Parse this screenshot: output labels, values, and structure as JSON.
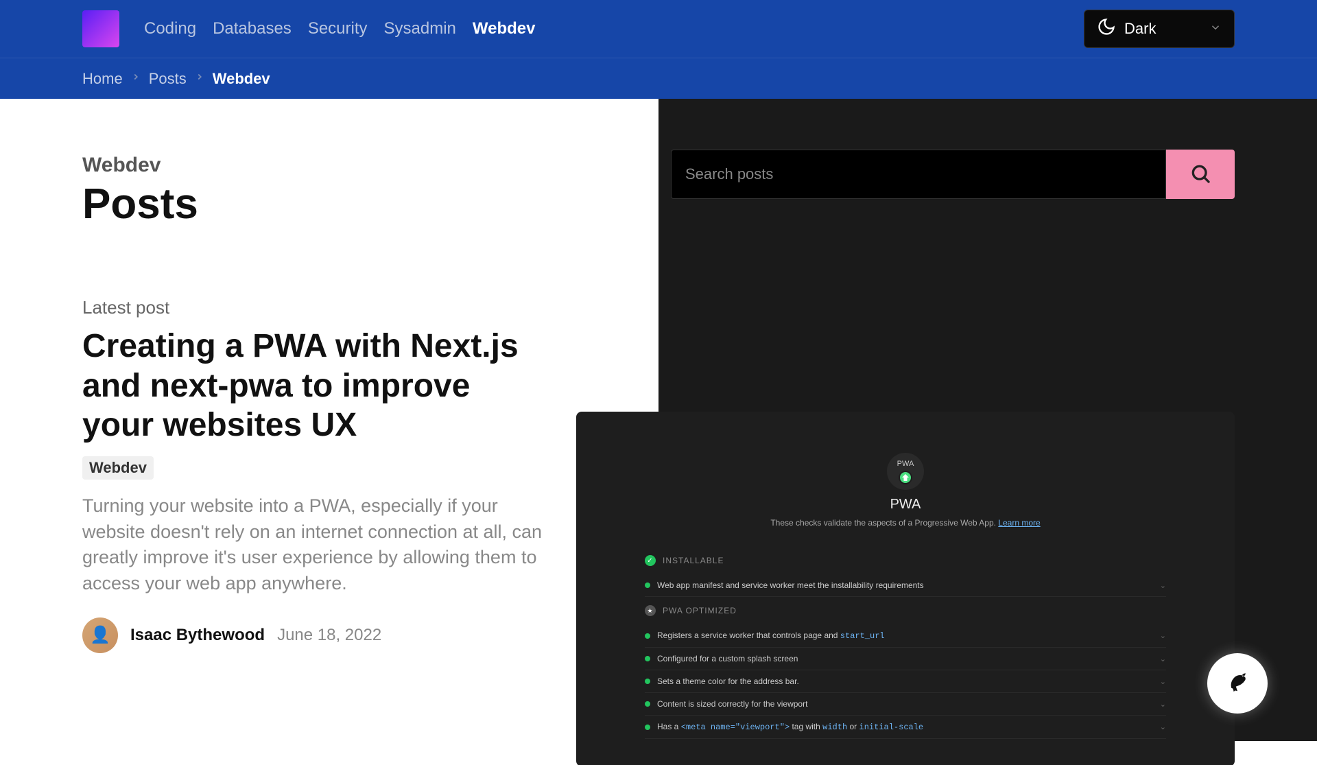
{
  "header": {
    "nav": [
      "Coding",
      "Databases",
      "Security",
      "Sysadmin",
      "Webdev"
    ],
    "active_nav": 4,
    "theme_label": "Dark"
  },
  "breadcrumb": [
    "Home",
    "Posts",
    "Webdev"
  ],
  "left": {
    "category": "Webdev",
    "page_title": "Posts",
    "latest_label": "Latest post",
    "post_title": "Creating a PWA with Next.js and next-pwa to improve your websites UX",
    "tag": "Webdev",
    "excerpt": "Turning your website into a PWA, especially if your website doesn't rely on an internet connection at all, can greatly improve it's user experience by allowing them to access your web app anywhere.",
    "author": "Isaac Bythewood",
    "date": "June 18, 2022"
  },
  "right": {
    "search_placeholder": "Search posts"
  },
  "thumb": {
    "badge_text": "PWA",
    "title": "PWA",
    "subtitle_text": "These checks validate the aspects of a Progressive Web App. ",
    "subtitle_link": "Learn more",
    "sections": [
      {
        "title": "INSTALLABLE",
        "dot": "green",
        "rows": [
          {
            "html": "Web app manifest and service worker meet the installability requirements"
          }
        ]
      },
      {
        "title": "PWA OPTIMIZED",
        "dot": "gray",
        "rows": [
          {
            "html": "Registers a service worker that controls page and <code>start_url</code>"
          },
          {
            "html": "Configured for a custom splash screen"
          },
          {
            "html": "Sets a theme color for the address bar."
          },
          {
            "html": "Content is sized correctly for the viewport"
          },
          {
            "html": "Has a <code>&lt;meta name=\"viewport\"&gt;</code> tag with <code>width</code> or <code>initial-scale</code>"
          }
        ]
      }
    ]
  }
}
